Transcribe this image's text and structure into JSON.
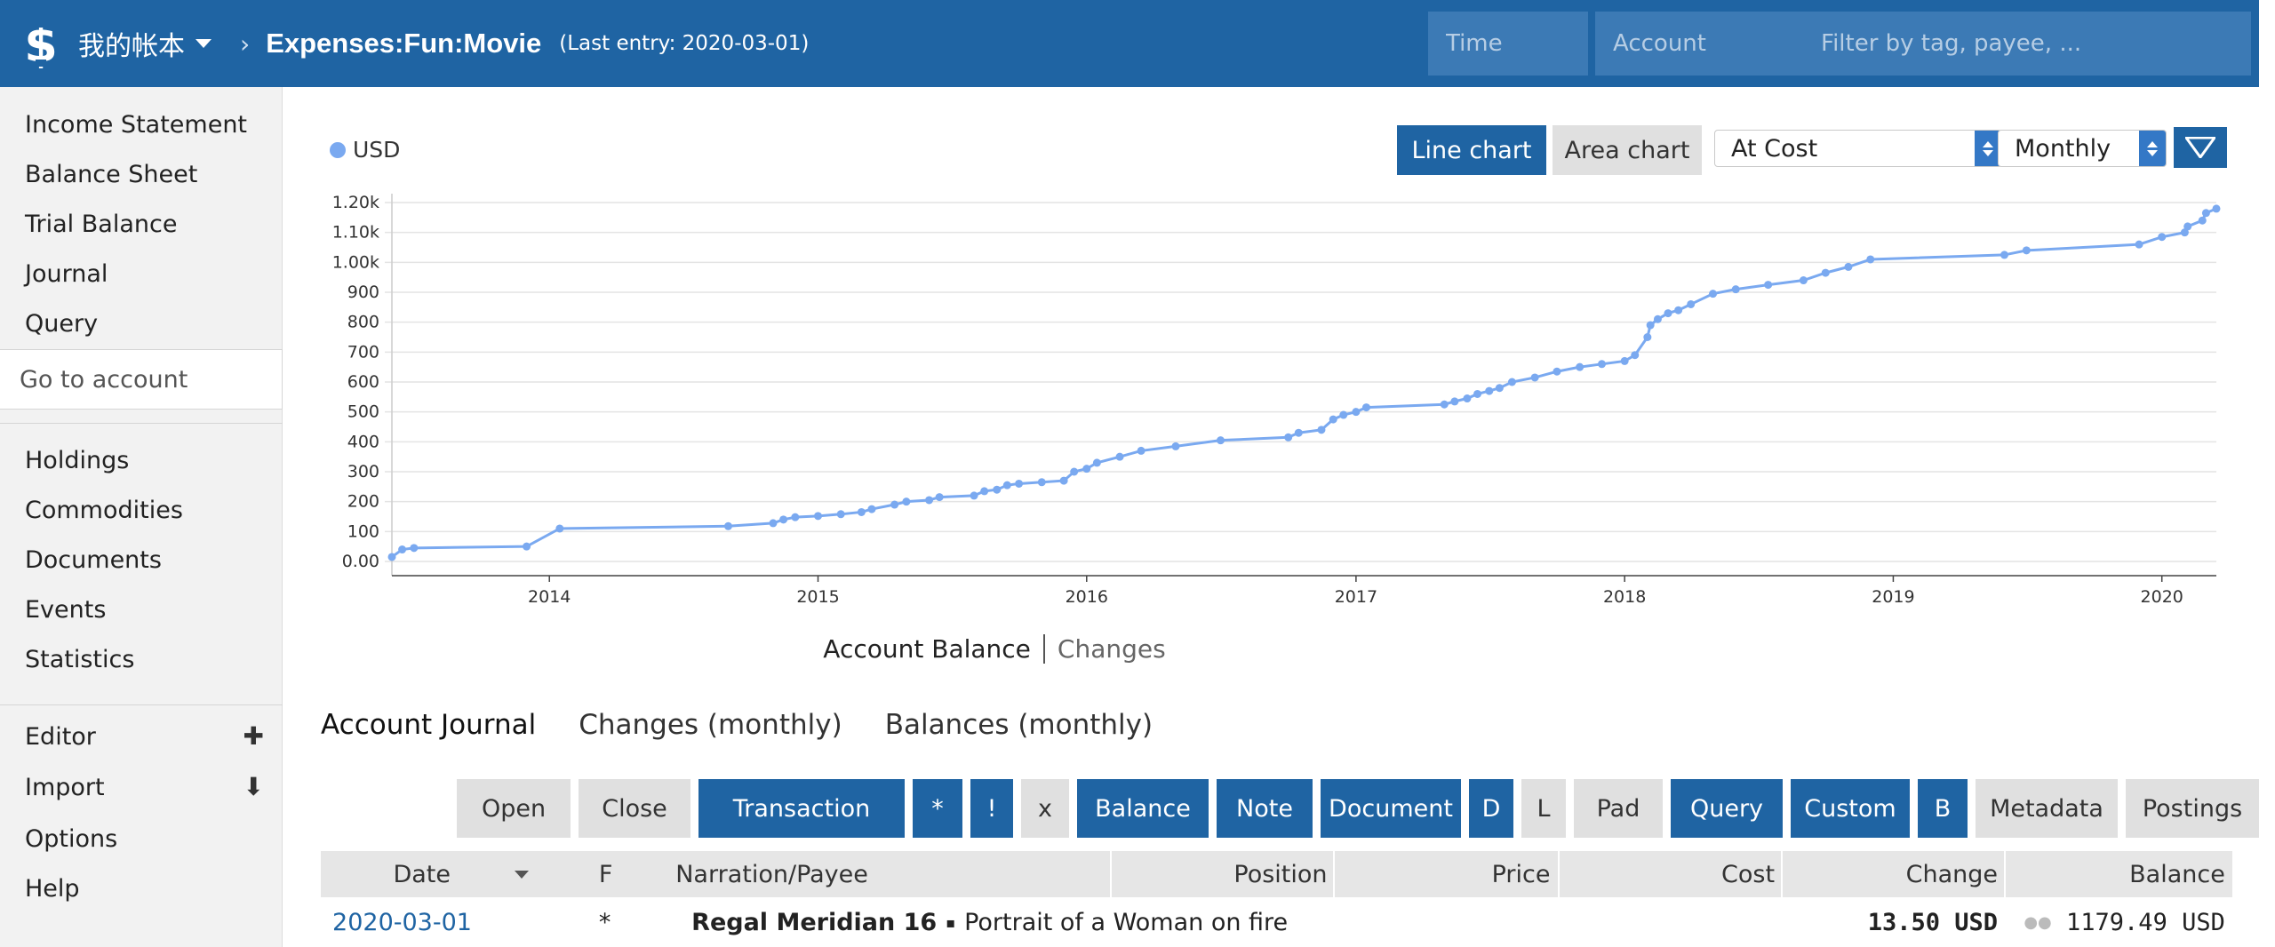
{
  "header": {
    "ledger_name": "我的帐本",
    "breadcrumb_separator": "›",
    "account": "Expenses:Fun:Movie",
    "last_entry": "(Last entry: 2020-03-01)",
    "time_placeholder": "Time",
    "account_placeholder": "Account",
    "filter_placeholder": "Filter by tag, payee, ..."
  },
  "sidebar": {
    "reports": [
      "Income Statement",
      "Balance Sheet",
      "Trial Balance",
      "Journal",
      "Query"
    ],
    "goto_account_placeholder": "Go to account",
    "sections": [
      "Holdings",
      "Commodities",
      "Documents",
      "Events",
      "Statistics"
    ],
    "tools": [
      {
        "label": "Editor",
        "action_icon": "plus-icon"
      },
      {
        "label": "Import",
        "action_icon": "download-arrow-icon"
      },
      {
        "label": "Options",
        "action_icon": ""
      },
      {
        "label": "Help",
        "action_icon": ""
      }
    ]
  },
  "chart_controls": {
    "legend_label": "USD",
    "line_chart": "Line chart",
    "area_chart": "Area chart",
    "conversion": "At Cost",
    "interval": "Monthly",
    "mode_active": "Account Balance",
    "mode_other": "Changes"
  },
  "colors": {
    "accent": "#1f64a3",
    "series": "#7aa9f0",
    "link": "#1f64a3"
  },
  "chart_data": {
    "type": "line",
    "series": [
      {
        "name": "USD",
        "points": [
          [
            "2013-06-01",
            15
          ],
          [
            "2013-06-15",
            40
          ],
          [
            "2013-07-01",
            45
          ],
          [
            "2013-12-01",
            50
          ],
          [
            "2014-01-15",
            110
          ],
          [
            "2014-09-01",
            118
          ],
          [
            "2014-11-01",
            128
          ],
          [
            "2014-11-15",
            140
          ],
          [
            "2014-12-01",
            148
          ],
          [
            "2015-01-01",
            152
          ],
          [
            "2015-02-01",
            158
          ],
          [
            "2015-03-01",
            165
          ],
          [
            "2015-03-15",
            175
          ],
          [
            "2015-04-15",
            190
          ],
          [
            "2015-05-01",
            200
          ],
          [
            "2015-06-01",
            205
          ],
          [
            "2015-06-15",
            215
          ],
          [
            "2015-08-01",
            220
          ],
          [
            "2015-08-15",
            235
          ],
          [
            "2015-09-01",
            240
          ],
          [
            "2015-09-15",
            255
          ],
          [
            "2015-10-01",
            260
          ],
          [
            "2015-11-01",
            265
          ],
          [
            "2015-12-01",
            270
          ],
          [
            "2015-12-15",
            300
          ],
          [
            "2016-01-01",
            310
          ],
          [
            "2016-01-15",
            330
          ],
          [
            "2016-02-15",
            350
          ],
          [
            "2016-03-15",
            370
          ],
          [
            "2016-05-01",
            385
          ],
          [
            "2016-07-01",
            405
          ],
          [
            "2016-10-01",
            415
          ],
          [
            "2016-10-15",
            430
          ],
          [
            "2016-11-15",
            440
          ],
          [
            "2016-12-01",
            475
          ],
          [
            "2016-12-15",
            490
          ],
          [
            "2017-01-01",
            500
          ],
          [
            "2017-01-15",
            515
          ],
          [
            "2017-05-01",
            525
          ],
          [
            "2017-05-15",
            535
          ],
          [
            "2017-06-01",
            545
          ],
          [
            "2017-06-15",
            560
          ],
          [
            "2017-07-01",
            570
          ],
          [
            "2017-07-15",
            580
          ],
          [
            "2017-08-01",
            600
          ],
          [
            "2017-09-01",
            615
          ],
          [
            "2017-10-01",
            635
          ],
          [
            "2017-11-01",
            650
          ],
          [
            "2017-12-01",
            660
          ],
          [
            "2018-01-01",
            670
          ],
          [
            "2018-01-15",
            690
          ],
          [
            "2018-02-01",
            750
          ],
          [
            "2018-02-05",
            790
          ],
          [
            "2018-02-15",
            810
          ],
          [
            "2018-03-01",
            830
          ],
          [
            "2018-03-15",
            840
          ],
          [
            "2018-04-01",
            860
          ],
          [
            "2018-05-01",
            895
          ],
          [
            "2018-06-01",
            910
          ],
          [
            "2018-07-15",
            925
          ],
          [
            "2018-09-01",
            940
          ],
          [
            "2018-10-01",
            965
          ],
          [
            "2018-11-01",
            985
          ],
          [
            "2018-12-01",
            1010
          ],
          [
            "2019-06-01",
            1025
          ],
          [
            "2019-07-01",
            1040
          ],
          [
            "2019-12-01",
            1060
          ],
          [
            "2020-01-01",
            1085
          ],
          [
            "2020-02-01",
            1100
          ],
          [
            "2020-02-05",
            1120
          ],
          [
            "2020-02-25",
            1140
          ],
          [
            "2020-03-01",
            1165
          ],
          [
            "2020-03-15",
            1179.49
          ]
        ]
      }
    ],
    "x_ticks": [
      "2014",
      "2015",
      "2016",
      "2017",
      "2018",
      "2019",
      "2020"
    ],
    "y_ticks": [
      "0.00",
      "100",
      "200",
      "300",
      "400",
      "500",
      "600",
      "700",
      "800",
      "900",
      "1.00k",
      "1.10k",
      "1.20k"
    ],
    "x_range": [
      "2013-06-01",
      "2020-03-15"
    ],
    "y_range": [
      0,
      1200
    ],
    "grid": true
  },
  "tabs": [
    "Account Journal",
    "Changes (monthly)",
    "Balances (monthly)"
  ],
  "filter_buttons": [
    {
      "label": "Open",
      "active": false
    },
    {
      "label": "Close",
      "active": false
    },
    {
      "label": "Transaction",
      "active": true
    },
    {
      "label": "*",
      "active": true
    },
    {
      "label": "!",
      "active": true
    },
    {
      "label": "x",
      "active": false
    },
    {
      "label": "Balance",
      "active": true
    },
    {
      "label": "Note",
      "active": true
    },
    {
      "label": "Document",
      "active": true
    },
    {
      "label": "D",
      "active": true
    },
    {
      "label": "L",
      "active": false
    },
    {
      "label": "Pad",
      "active": false
    },
    {
      "label": "Query",
      "active": true
    },
    {
      "label": "Custom",
      "active": true
    },
    {
      "label": "B",
      "active": true
    },
    {
      "label": "Metadata",
      "active": false
    },
    {
      "label": "Postings",
      "active": false
    }
  ],
  "journal": {
    "columns": [
      "Date",
      "F",
      "Narration/Payee",
      "Position",
      "Price",
      "Cost",
      "Change",
      "Balance"
    ],
    "rows": [
      {
        "date": "2020-03-01",
        "flag": "*",
        "payee": "Regal Meridian 16",
        "separator": "▪",
        "narration": "Portrait of a Woman on fire",
        "change": "13.50 USD",
        "balance": "1179.49 USD"
      }
    ]
  }
}
